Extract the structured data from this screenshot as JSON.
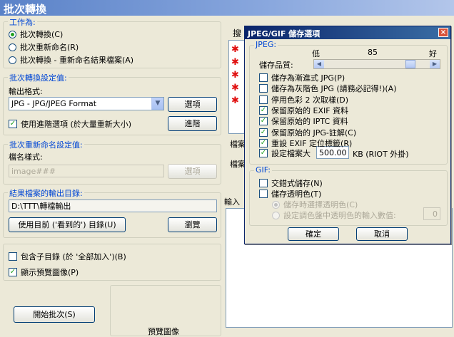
{
  "window": {
    "title": "批次轉換"
  },
  "work": {
    "legend": "工作為:",
    "options": [
      "批次轉換(C)",
      "批次重新命名(R)",
      "批次轉換 - 重新命名結果檔案(A)"
    ],
    "selected": 0
  },
  "convert": {
    "legend": "批次轉換設定值:",
    "format_label": "輸出格式:",
    "format_value": "JPG - JPG/JPEG Format",
    "options_button": "選項",
    "advanced_check": "使用進階選項 (於大量重新大小)",
    "advanced_checked": true,
    "advanced_button": "進階"
  },
  "rename": {
    "legend": "批次重新命名設定值:",
    "pattern_label": "檔名樣式:",
    "pattern_value": "image###",
    "options_button": "選項"
  },
  "output": {
    "legend": "結果檔案的輸出目錄:",
    "path": "D:\\TTT\\轉檔輸出",
    "use_current_button": "使用目前 ('看到的') 目錄(U)",
    "browse_button": "瀏覽"
  },
  "extra": {
    "subdirs": "包含子目錄 (於 '全部加入')(B)",
    "subdirs_checked": false,
    "preview": "顯示預覽圖像(P)",
    "preview_checked": true
  },
  "start_button": "開始批次(S)",
  "preview_caption": "預覽圖像",
  "right": {
    "search_label": "搜",
    "label_file1": "檔案",
    "label_file2": "檔案",
    "label_input": "輸入"
  },
  "dialog": {
    "title": "JPEG/GIF 儲存選項",
    "jpeg_legend": "JPEG:",
    "quality_label": "儲存品質:",
    "quality_low": "低",
    "quality_value": "85",
    "quality_high": "好",
    "quality_fraction": 0.85,
    "jpeg_options": [
      {
        "label": "儲存為漸進式 JPG(P)",
        "checked": false
      },
      {
        "label": "儲存為灰階色 JPG (請務必記得!)(A)",
        "checked": false
      },
      {
        "label": "停用色彩 2 次取樣(D)",
        "checked": false
      },
      {
        "label": "保留原始的 EXIF 資料",
        "checked": true
      },
      {
        "label": "保留原始的 IPTC 資料",
        "checked": true
      },
      {
        "label": "保留原始的 JPG-註解(C)",
        "checked": true
      },
      {
        "label": "重設 EXIF 定位標籤(R)",
        "checked": true
      }
    ],
    "filesize_label": "設定檔案大",
    "filesize_checked": true,
    "filesize_value": "500.00",
    "filesize_unit": "KB (RIOT 外掛)",
    "gif_legend": "GIF:",
    "interlace": "交錯式儲存(N)",
    "transparent": "儲存透明色(T)",
    "pick_transparent": "儲存時選擇透明色(C)",
    "palette_transparent": "設定調色盤中透明色的輸入數值:",
    "palette_value": "0",
    "ok_button": "確定",
    "cancel_button": "取消"
  }
}
